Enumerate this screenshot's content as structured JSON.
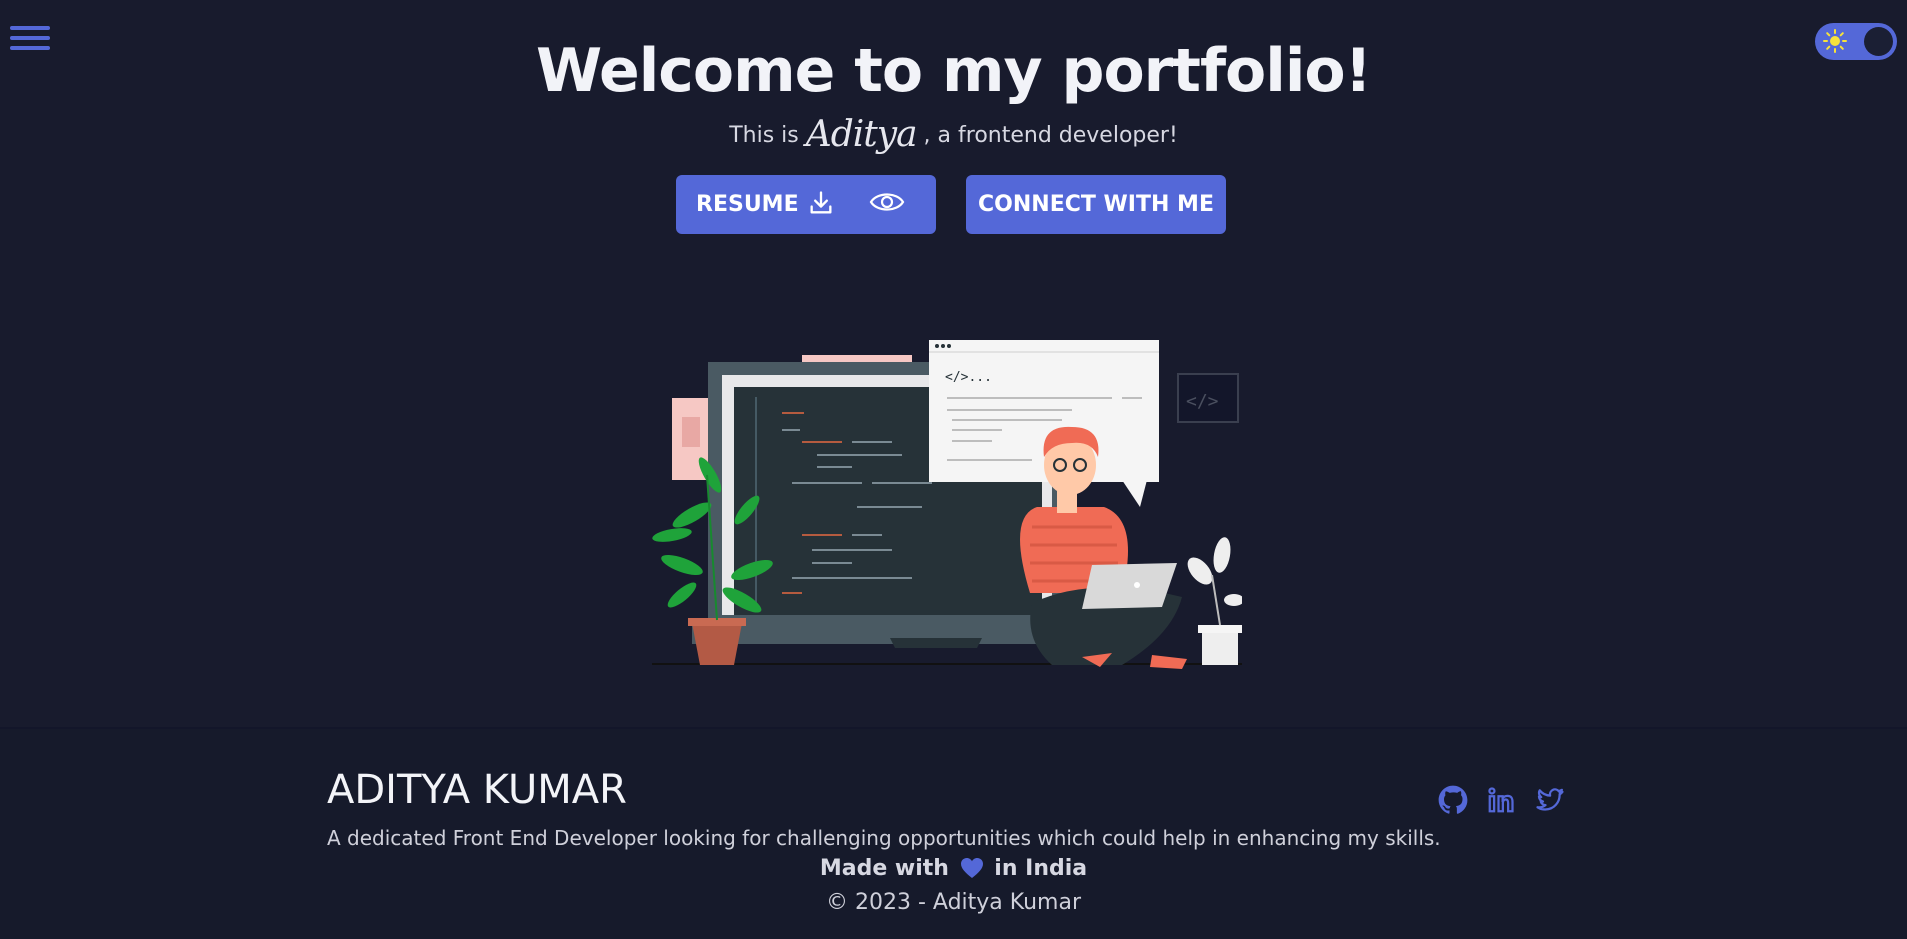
{
  "header": {
    "menu_icon": "hamburger-menu-icon",
    "theme_toggle_icon": "sun-icon"
  },
  "hero": {
    "title": "Welcome to my portfolio!",
    "subtitle_prefix": "This is ",
    "subtitle_name": "Aditya",
    "subtitle_suffix": " , a frontend developer!",
    "resume_label": "RESUME",
    "resume_icons": [
      "download-icon",
      "eye-icon"
    ],
    "connect_label": "CONNECT WITH ME",
    "illustration": "developer-with-laptop-illustration",
    "code_tag_text": "</>...",
    "code_badge_text": "</>"
  },
  "footer": {
    "name": "ADITYA KUMAR",
    "description": "A dedicated Front End Developer looking for challenging opportunities which could help in enhancing my skills.",
    "made_with_prefix": "Made with",
    "made_with_suffix": "in India",
    "copyright": "© 2023 - Aditya Kumar",
    "social_icons": [
      "github-icon",
      "linkedin-icon",
      "twitter-icon"
    ]
  },
  "colors": {
    "background": "#181b2d",
    "accent": "#5468d8",
    "footer_background": "#161a2b",
    "text": "#e6e7ee"
  }
}
